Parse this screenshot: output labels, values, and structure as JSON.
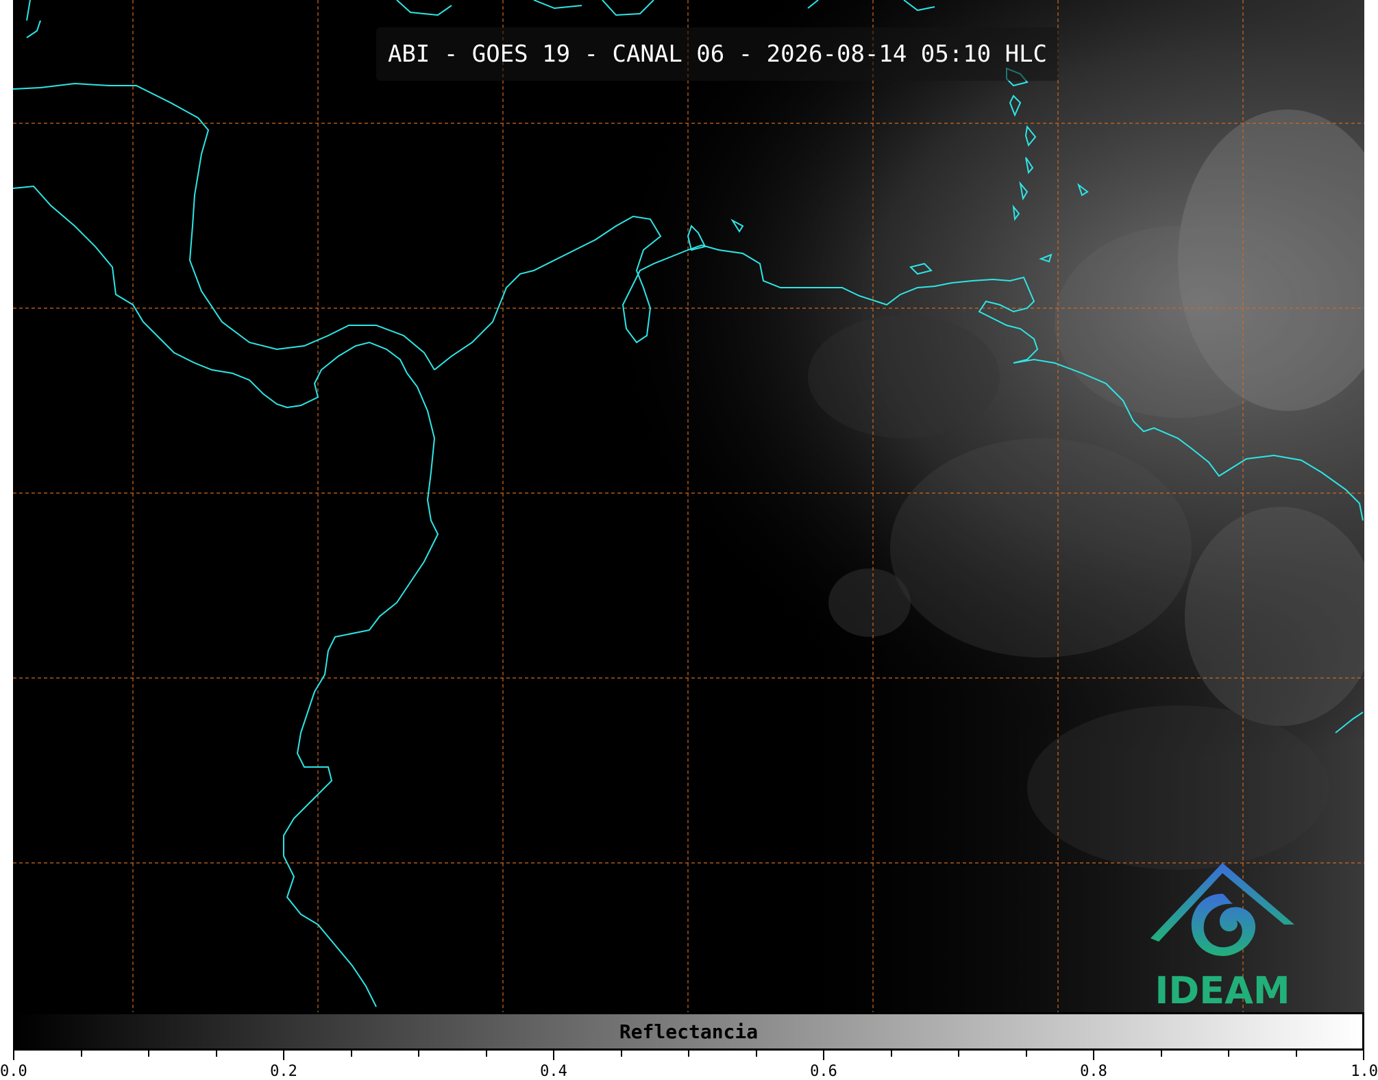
{
  "title": "ABI - GOES 19 - CANAL 06 - 2026-08-14 05:10 HLC",
  "logo": {
    "text": "IDEAM",
    "icon": "ideam-logo-icon"
  },
  "colorbar": {
    "label": "Reflectancia",
    "range": [
      0.0,
      1.0
    ],
    "tick_labels": [
      "0.0",
      "0.2",
      "0.4",
      "0.6",
      "0.8",
      "1.0"
    ],
    "colors": {
      "low": "#000000",
      "high": "#ffffff"
    }
  },
  "colors": {
    "coastline": "#2ee6e6",
    "gridline": "#d2691e",
    "background": "#000000"
  }
}
